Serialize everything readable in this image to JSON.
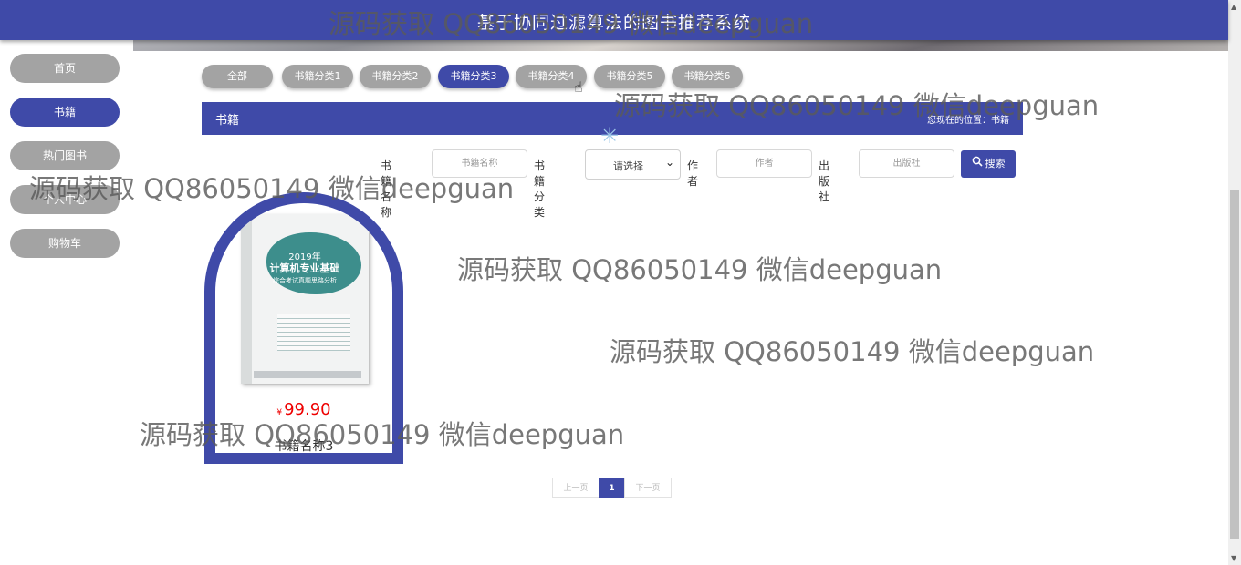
{
  "header": {
    "title": "基于协同过滤算法的图书推荐系统"
  },
  "sidebar": {
    "items": [
      {
        "label": "首页"
      },
      {
        "label": "书籍"
      },
      {
        "label": "热门图书"
      },
      {
        "label": "个人中心"
      },
      {
        "label": "购物车"
      }
    ]
  },
  "categories": [
    "全部",
    "书籍分类1",
    "书籍分类2",
    "书籍分类3",
    "书籍分类4",
    "书籍分类5",
    "书籍分类6"
  ],
  "section": {
    "title": "书籍",
    "breadcrumb": "您现在的位置：书籍"
  },
  "search": {
    "name_label": "书籍名称",
    "name_placeholder": "书籍名称",
    "category_label": "书籍分类",
    "category_value": "请选择",
    "author_label": "作者",
    "author_placeholder": "作者",
    "publisher_label": "出版社",
    "publisher_placeholder": "出版社",
    "button_label": "搜索"
  },
  "book": {
    "cover": {
      "year": "2019年",
      "title": "计算机专业基础",
      "subtitle": "综合考试真题思路分析"
    },
    "price_symbol": "¥",
    "price": "99.90",
    "name": "书籍名称3"
  },
  "pagination": {
    "prev": "上一页",
    "current": "1",
    "next": "下一页"
  },
  "watermarks": [
    "源码获取 QQ86050149 微信deepguan",
    "源码获取 QQ86050149 微信deepguan",
    "源码获取 QQ86050149 微信deepguan",
    "源码获取 QQ86050149 微信deepguan",
    "源码获取 QQ86050149 微信deepguan",
    "源码获取 QQ86050149 微信deepguan"
  ],
  "colors": {
    "accent": "#3f4aa8",
    "inactive": "#a3a3a3",
    "price": "#e00000"
  },
  "icons": {
    "search": "search-icon",
    "dropdown": "chevron-down-icon",
    "loading": "loading-spinner-icon",
    "cursor": "hand-cursor-icon"
  }
}
